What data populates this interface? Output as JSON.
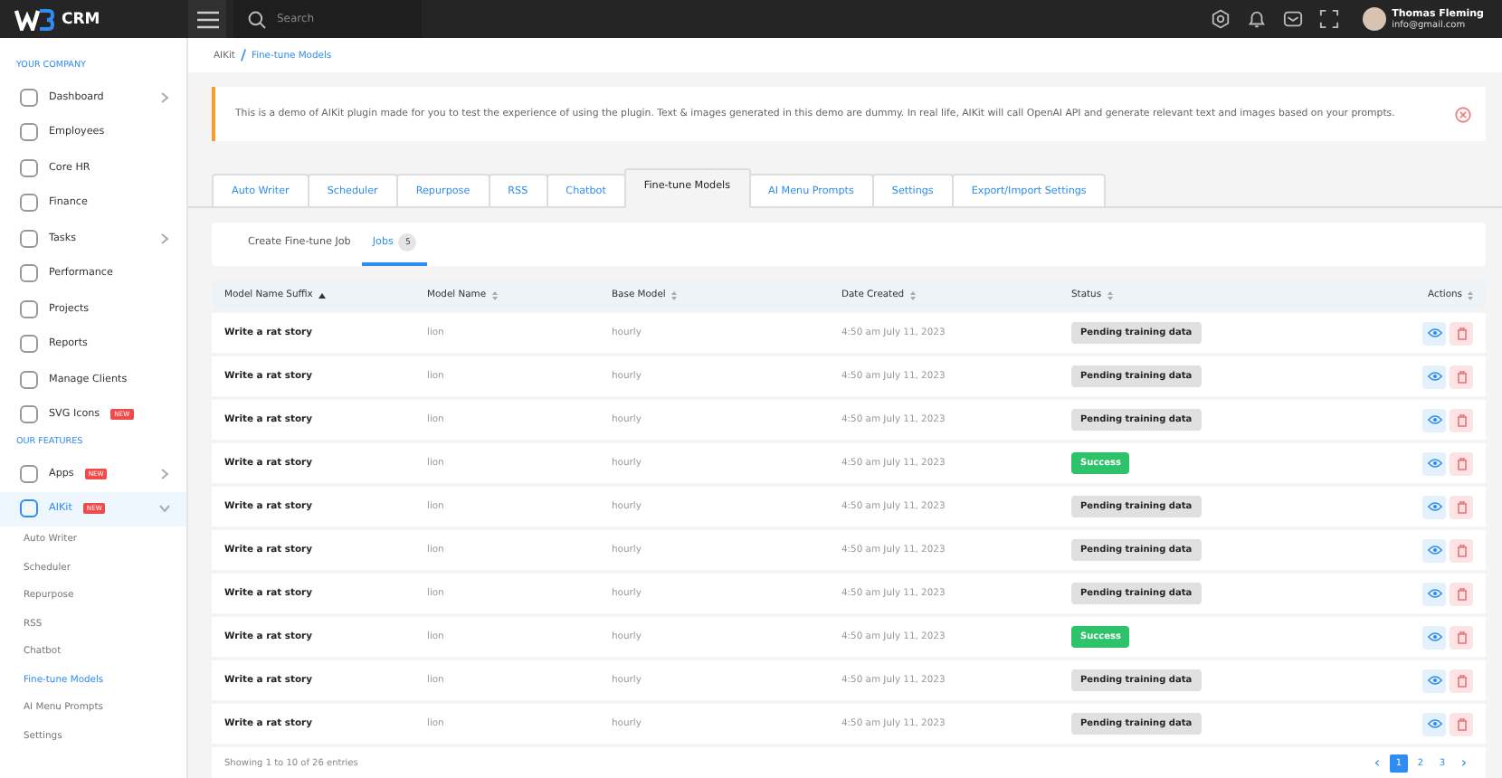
{
  "header": {
    "brand": "CRM",
    "search": {
      "placeholder": "Search"
    },
    "user": {
      "name": "Thomas Fleming",
      "email": "info@gmail.com"
    }
  },
  "sidebar": {
    "sections": [
      {
        "heading": "YOUR COMPANY",
        "items": [
          {
            "label": "Dashboard",
            "selected": false,
            "expanded": false
          },
          {
            "label": "Employees",
            "selected": false
          },
          {
            "label": "Core HR",
            "selected": false
          },
          {
            "label": "Finance",
            "selected": false
          },
          {
            "label": "Tasks",
            "selected": false,
            "expanded": false
          },
          {
            "label": "Performance",
            "selected": false
          },
          {
            "label": "Projects",
            "selected": false
          },
          {
            "label": "Reports",
            "selected": false
          },
          {
            "label": "Manage Clients",
            "selected": false
          },
          {
            "label": "SVG Icons",
            "selected": false,
            "badge": "NEW"
          }
        ]
      },
      {
        "heading": "OUR FEATURES",
        "items": [
          {
            "label": "Apps",
            "selected": false,
            "badge": "NEW",
            "expanded": false
          },
          {
            "label": "AIKit",
            "selected": true,
            "badge": "NEW",
            "expanded": true,
            "children": [
              {
                "label": "Auto Writer",
                "selected": false
              },
              {
                "label": "Scheduler",
                "selected": false
              },
              {
                "label": "Repurpose",
                "selected": false
              },
              {
                "label": "RSS",
                "selected": false
              },
              {
                "label": "Chatbot",
                "selected": false
              },
              {
                "label": "Fine-tune Models",
                "selected": true
              },
              {
                "label": "AI Menu Prompts",
                "selected": false
              },
              {
                "label": "Settings",
                "selected": false
              }
            ]
          }
        ]
      }
    ]
  },
  "breadcrumb": [
    "AIKit",
    "Fine-tune Models"
  ],
  "alert": {
    "text": "This is a demo of AIKit plugin made for you to test the experience of using the plugin. Text & images generated in this demo are dummy. In real life, AIKit will call OpenAI API and generate relevant text and images based on your prompts."
  },
  "tabs": [
    {
      "label": "Auto Writer",
      "selected": false
    },
    {
      "label": "Scheduler",
      "selected": false
    },
    {
      "label": "Repurpose",
      "selected": false
    },
    {
      "label": "RSS",
      "selected": false
    },
    {
      "label": "Chatbot",
      "selected": false
    },
    {
      "label": "Fine-tune Models",
      "selected": true
    },
    {
      "label": "AI Menu Prompts",
      "selected": false
    },
    {
      "label": "Settings",
      "selected": false
    },
    {
      "label": "Export/Import Settings",
      "selected": false
    }
  ],
  "subtabs": [
    {
      "label": "Create Fine-tune Job",
      "selected": false
    },
    {
      "label": "Jobs",
      "count": "5",
      "selected": true
    }
  ],
  "table": {
    "columns": [
      {
        "label": "Model Name Suffix",
        "sorted": true
      },
      {
        "label": "Model Name",
        "sorted": false
      },
      {
        "label": "Base Model",
        "sorted": false
      },
      {
        "label": "Date Created",
        "sorted": false
      },
      {
        "label": "Status",
        "sorted": false
      },
      {
        "label": "Actions",
        "sorted": false
      }
    ],
    "rows": [
      {
        "suffix": "Write a rat story",
        "model": "lion",
        "base": "hourly",
        "date": "4:50 am July 11, 2023",
        "status": {
          "label": "Pending training data",
          "kind": "pending"
        }
      },
      {
        "suffix": "Write a rat story",
        "model": "lion",
        "base": "hourly",
        "date": "4:50 am July 11, 2023",
        "status": {
          "label": "Pending training data",
          "kind": "pending"
        }
      },
      {
        "suffix": "Write a rat story",
        "model": "lion",
        "base": "hourly",
        "date": "4:50 am July 11, 2023",
        "status": {
          "label": "Pending training data",
          "kind": "pending"
        }
      },
      {
        "suffix": "Write a rat story",
        "model": "lion",
        "base": "hourly",
        "date": "4:50 am July 11, 2023",
        "status": {
          "label": "Success",
          "kind": "success"
        }
      },
      {
        "suffix": "Write a rat story",
        "model": "lion",
        "base": "hourly",
        "date": "4:50 am July 11, 2023",
        "status": {
          "label": "Pending training data",
          "kind": "pending"
        }
      },
      {
        "suffix": "Write a rat story",
        "model": "lion",
        "base": "hourly",
        "date": "4:50 am July 11, 2023",
        "status": {
          "label": "Pending training data",
          "kind": "pending"
        }
      },
      {
        "suffix": "Write a rat story",
        "model": "lion",
        "base": "hourly",
        "date": "4:50 am July 11, 2023",
        "status": {
          "label": "Pending training data",
          "kind": "pending"
        }
      },
      {
        "suffix": "Write a rat story",
        "model": "lion",
        "base": "hourly",
        "date": "4:50 am July 11, 2023",
        "status": {
          "label": "Success",
          "kind": "success"
        }
      },
      {
        "suffix": "Write a rat story",
        "model": "lion",
        "base": "hourly",
        "date": "4:50 am July 11, 2023",
        "status": {
          "label": "Pending training data",
          "kind": "pending"
        }
      },
      {
        "suffix": "Write a rat story",
        "model": "lion",
        "base": "hourly",
        "date": "4:50 am July 11, 2023",
        "status": {
          "label": "Pending training data",
          "kind": "pending"
        }
      }
    ]
  },
  "footer": {
    "info": "Showing 1 to 10 of 26 entries",
    "pagination": {
      "prev": "‹",
      "next": "›",
      "pages": [
        {
          "label": "1",
          "selected": true
        },
        {
          "label": "2",
          "selected": false
        },
        {
          "label": "3",
          "selected": false
        }
      ]
    }
  }
}
